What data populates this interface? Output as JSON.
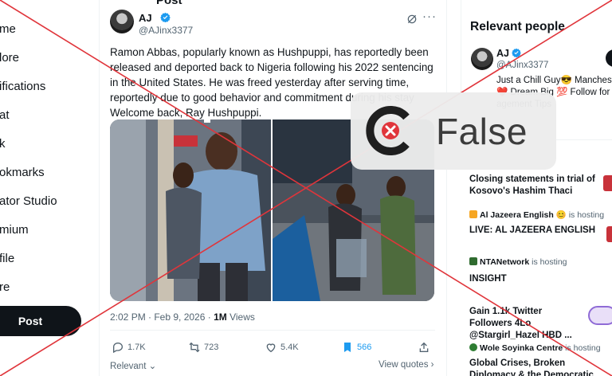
{
  "top_bar": {
    "title": "Post"
  },
  "nav": {
    "items": [
      "me",
      "lore",
      "ifications",
      "at",
      "k",
      "okmarks",
      "ator Studio",
      "mium",
      "file",
      "re"
    ],
    "post_button": "Post"
  },
  "tweet": {
    "author_name": "AJ",
    "author_handle": "@AJinx3377",
    "text": "Ramon Abbas, popularly known as Hushpuppi, has reportedly been released and deported back to Nigeria following his 2022 sentencing in the United States. He was freed yesterday after serving time, reportedly due to good behavior and commitment during his stay Welcome back, Ray Hushpuppi.",
    "time": "2:02 PM · Feb 9, 2026 · ",
    "views_count": "1M",
    "views_label": " Views",
    "replies": "1.7K",
    "reposts": "723",
    "likes": "5.4K",
    "bookmarks": "566",
    "sort_label": "Relevant",
    "view_quotes": "View quotes"
  },
  "right": {
    "relevant_title": "Relevant people",
    "person": {
      "name": "AJ",
      "handle": "@AJinx3377",
      "bio_1": "Just a Chill Guy😎 Mancheste",
      "bio_2": "❤️ Dream Big 💯 Follow for",
      "bio_3": "agement Tips"
    },
    "trends": [
      {
        "title": "Closing statements in trial of Kosovo's Hashim Thaci"
      },
      {
        "source": "Al Jazeera English",
        "emoji": " 😊",
        "status": " is hosting",
        "title": "LIVE: AL JAZEERA ENGLISH"
      },
      {
        "source": "NTANetwork",
        "status": " is hosting",
        "title": "INSIGHT"
      },
      {
        "title": "Gain 1.1k Twitter Followers 4Lo @Stargirl_Hazel HBD ..."
      },
      {
        "source": "Wole Soyinka Centre",
        "status": " is hosting",
        "title": "Global Crises, Broken Diplomacy & the Democratic Burden of"
      }
    ]
  },
  "overlay": {
    "verdict": "False",
    "cross_color": "#e0353b",
    "logo_color": "#1f1f1f"
  },
  "colors": {
    "accent": "#1d9bf0",
    "text": "#0f1419",
    "muted": "#536471"
  }
}
